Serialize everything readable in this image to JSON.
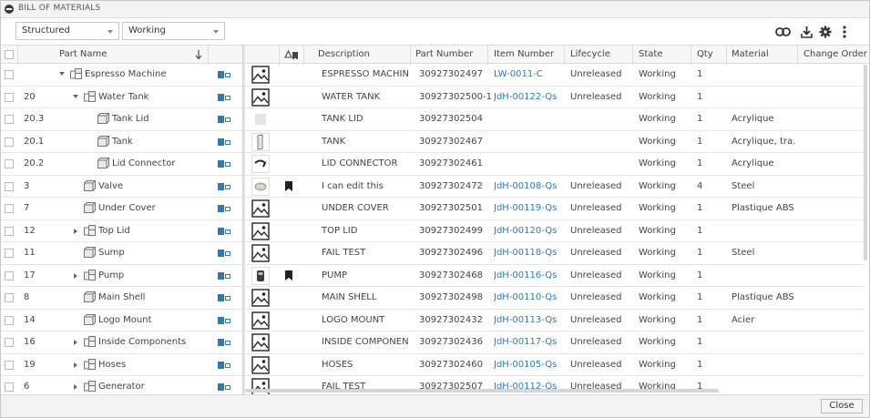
{
  "panel": {
    "title": "BILL OF MATERIALS"
  },
  "toolbar": {
    "view_select": "Structured",
    "revision_select": "Working"
  },
  "columns": {
    "part_name": "Part Name",
    "description": "Description",
    "part_number": "Part Number",
    "item_number": "Item Number",
    "lifecycle": "Lifecycle",
    "state": "State",
    "qty": "Qty",
    "material": "Material",
    "change_order": "Change Order"
  },
  "rows": [
    {
      "item": "",
      "name": "Espresso Machine",
      "desc": "ESPRESSO MACHINE",
      "pn": "30927302497",
      "itemnum": "LW-0011-C",
      "lifecycle": "Unreleased",
      "state": "Working",
      "qty": "1",
      "material": ""
    },
    {
      "item": "20",
      "name": "Water Tank",
      "desc": "WATER TANK",
      "pn": "30927302500-1",
      "itemnum": "JdH-00122-Qs",
      "lifecycle": "Unreleased",
      "state": "Working",
      "qty": "1",
      "material": ""
    },
    {
      "item": "20.3",
      "name": "Tank Lid",
      "desc": "TANK LID",
      "pn": "30927302504",
      "itemnum": "",
      "lifecycle": "",
      "state": "Working",
      "qty": "1",
      "material": "Acrylique"
    },
    {
      "item": "20.1",
      "name": "Tank",
      "desc": "TANK",
      "pn": "30927302467",
      "itemnum": "",
      "lifecycle": "",
      "state": "Working",
      "qty": "1",
      "material": "Acrylique, tra..."
    },
    {
      "item": "20.2",
      "name": "Lid Connector",
      "desc": "LID CONNECTOR",
      "pn": "30927302461",
      "itemnum": "",
      "lifecycle": "",
      "state": "Working",
      "qty": "1",
      "material": "Acrylique"
    },
    {
      "item": "3",
      "name": "Valve",
      "desc": "I can edit this",
      "pn": "30927302472",
      "itemnum": "JdH-00108-Qs",
      "lifecycle": "Unreleased",
      "state": "Working",
      "qty": "4",
      "material": "Steel"
    },
    {
      "item": "7",
      "name": "Under Cover",
      "desc": "UNDER COVER",
      "pn": "30927302501",
      "itemnum": "JdH-00119-Qs",
      "lifecycle": "Unreleased",
      "state": "Working",
      "qty": "1",
      "material": "Plastique ABS"
    },
    {
      "item": "12",
      "name": "Top Lid",
      "desc": "TOP LID",
      "pn": "30927302499",
      "itemnum": "JdH-00120-Qs",
      "lifecycle": "Unreleased",
      "state": "Working",
      "qty": "1",
      "material": ""
    },
    {
      "item": "11",
      "name": "Sump",
      "desc": "FAIL TEST",
      "pn": "30927302496",
      "itemnum": "JdH-00118-Qs",
      "lifecycle": "Unreleased",
      "state": "Working",
      "qty": "1",
      "material": "Steel"
    },
    {
      "item": "17",
      "name": "Pump",
      "desc": "PUMP",
      "pn": "30927302468",
      "itemnum": "JdH-00116-Qs",
      "lifecycle": "Unreleased",
      "state": "Working",
      "qty": "1",
      "material": ""
    },
    {
      "item": "8",
      "name": "Main Shell",
      "desc": "MAIN SHELL",
      "pn": "30927302498",
      "itemnum": "JdH-00110-Qs",
      "lifecycle": "Unreleased",
      "state": "Working",
      "qty": "1",
      "material": "Plastique ABS"
    },
    {
      "item": "14",
      "name": "Logo Mount",
      "desc": "LOGO MOUNT",
      "pn": "30927302432",
      "itemnum": "JdH-00113-Qs",
      "lifecycle": "Unreleased",
      "state": "Working",
      "qty": "1",
      "material": "Acier"
    },
    {
      "item": "16",
      "name": "Inside Components",
      "desc": "INSIDE COMPONENTS",
      "pn": "30927302436",
      "itemnum": "JdH-00117-Qs",
      "lifecycle": "Unreleased",
      "state": "Working",
      "qty": "1",
      "material": ""
    },
    {
      "item": "19",
      "name": "Hoses",
      "desc": "HOSES",
      "pn": "30927302460",
      "itemnum": "JdH-00105-Qs",
      "lifecycle": "Unreleased",
      "state": "Working",
      "qty": "1",
      "material": ""
    },
    {
      "item": "6",
      "name": "Generator",
      "desc": "FAIL TEST",
      "pn": "30927302507",
      "itemnum": "JdH-00112-Qs",
      "lifecycle": "Unreleased",
      "state": "Working",
      "qty": "1",
      "material": ""
    }
  ],
  "footer": {
    "close_label": "Close"
  }
}
